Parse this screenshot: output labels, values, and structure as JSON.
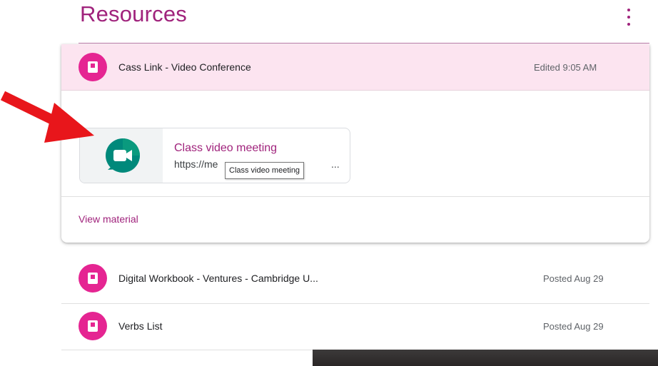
{
  "page": {
    "title": "Resources"
  },
  "expanded_item": {
    "title": "Cass Link - Video Conference",
    "meta": "Edited 9:05 AM",
    "link": {
      "title": "Class video meeting",
      "url": "https://me",
      "url_ellipsis": "..."
    },
    "tooltip": "Class video meeting",
    "view_material": "View material"
  },
  "items": [
    {
      "title": "Digital Workbook - Ventures - Cambridge U...",
      "meta": "Posted Aug 29"
    },
    {
      "title": "Verbs List",
      "meta": "Posted Aug 29"
    }
  ],
  "colors": {
    "accent": "#a0237c",
    "icon_bg": "#e52592",
    "header_bg": "#fce4f0",
    "annotation_arrow": "#e8161b",
    "meet_green": "#00832d"
  },
  "icons": {
    "item_icon": "material-icon",
    "link_thumb": "google-meet-icon",
    "menu": "more-vert-icon"
  }
}
